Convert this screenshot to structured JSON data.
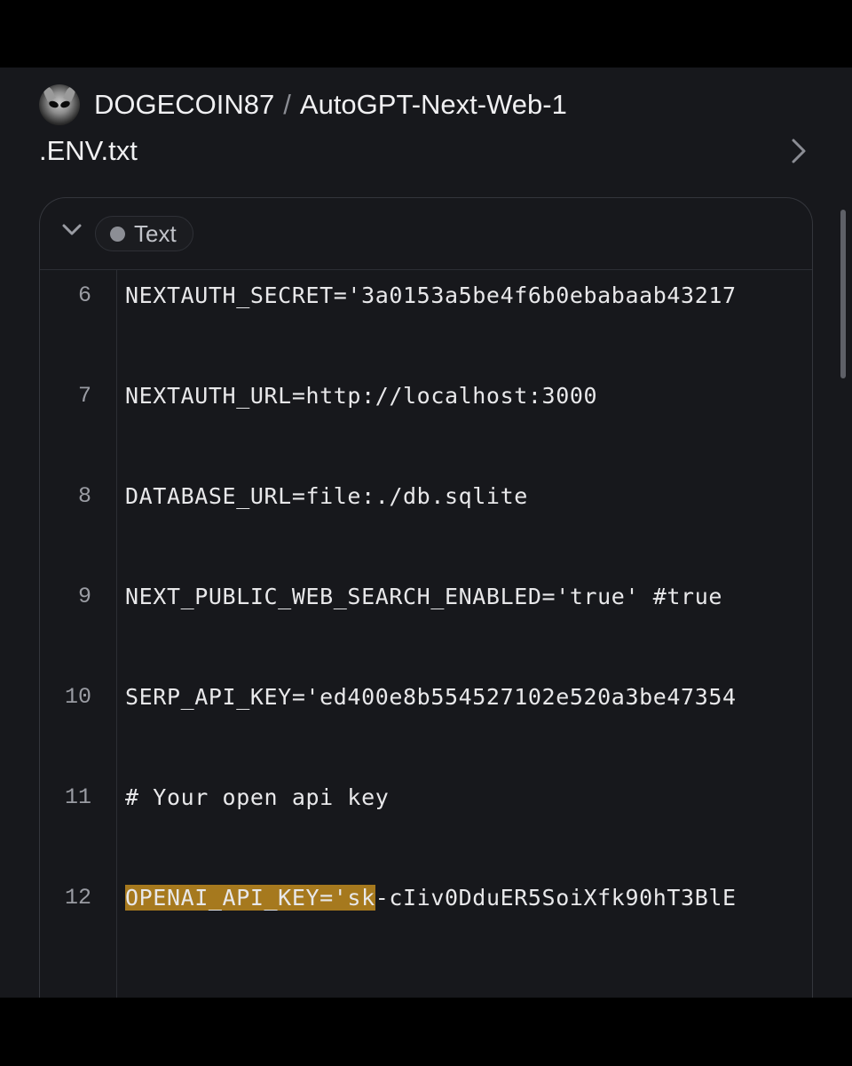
{
  "repo": {
    "owner": "DOGECOIN87",
    "separator": "/",
    "name": "AutoGPT-Next-Web-1"
  },
  "file": {
    "name": ".ENV.txt"
  },
  "viewer": {
    "language": "Text"
  },
  "code_lines": [
    {
      "number": "6",
      "text": "NEXTAUTH_SECRET='3a0153a5be4f6b0ebabaab43217"
    },
    {
      "number": "7",
      "text": "NEXTAUTH_URL=http://localhost:3000"
    },
    {
      "number": "8",
      "text": "DATABASE_URL=file:./db.sqlite"
    },
    {
      "number": "9",
      "text": "NEXT_PUBLIC_WEB_SEARCH_ENABLED='true' #true"
    },
    {
      "number": "10",
      "text": "SERP_API_KEY='ed400e8b554527102e520a3be47354"
    },
    {
      "number": "11",
      "text": "# Your open api key"
    },
    {
      "number": "12",
      "text_highlighted": "OPENAI_API_KEY='sk",
      "text_rest": "-cIiv0DduER5SoiXfk90hT3BlE"
    }
  ],
  "highlight_color": "#a6791e"
}
